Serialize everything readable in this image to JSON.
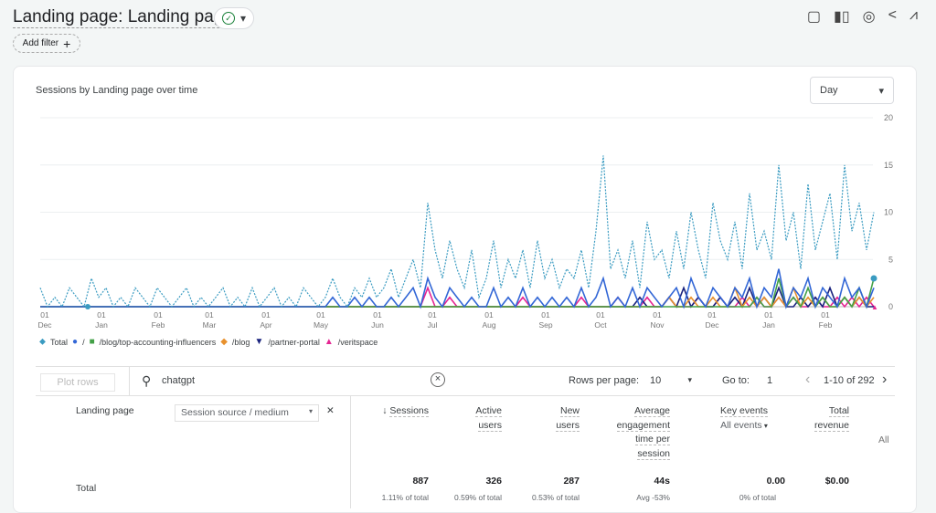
{
  "header": {
    "title": "Landing page: Landing page",
    "add_filter": "Add filter",
    "tools": [
      "note-icon",
      "compare-icon",
      "insights-icon",
      "share-icon",
      "trend-icon"
    ]
  },
  "card": {
    "title": "Sessions by Landing page over time",
    "granularity": "Day"
  },
  "chart_data": {
    "type": "line",
    "x_unit": "day",
    "x_start": "Dec 01",
    "x_step_days": 4,
    "x_ticks": [
      [
        "01",
        "Dec"
      ],
      [
        "01",
        "Jan"
      ],
      [
        "01",
        "Feb"
      ],
      [
        "01",
        "Mar"
      ],
      [
        "01",
        "Apr"
      ],
      [
        "01",
        "May"
      ],
      [
        "01",
        "Jun"
      ],
      [
        "01",
        "Jul"
      ],
      [
        "01",
        "Aug"
      ],
      [
        "01",
        "Sep"
      ],
      [
        "01",
        "Oct"
      ],
      [
        "01",
        "Nov"
      ],
      [
        "01",
        "Dec"
      ],
      [
        "01",
        "Jan"
      ],
      [
        "01",
        "Feb"
      ]
    ],
    "y_ticks": [
      "0",
      "5",
      "10",
      "15",
      "20"
    ],
    "ylim": [
      0,
      20
    ],
    "grid": true,
    "legend": "bottom-left",
    "series": [
      {
        "name": "Total",
        "color": "#3a9bc1",
        "dashed": true,
        "values": [
          2,
          0,
          1,
          0,
          2,
          1,
          0,
          3,
          1,
          2,
          0,
          1,
          0,
          2,
          1,
          0,
          2,
          1,
          0,
          1,
          2,
          0,
          1,
          0,
          1,
          2,
          0,
          1,
          0,
          2,
          0,
          1,
          2,
          0,
          1,
          0,
          2,
          1,
          0,
          1,
          3,
          1,
          0,
          2,
          1,
          3,
          1,
          2,
          4,
          1,
          3,
          5,
          2,
          11,
          6,
          3,
          7,
          4,
          2,
          6,
          1,
          3,
          7,
          2,
          5,
          3,
          6,
          2,
          7,
          3,
          5,
          2,
          4,
          3,
          6,
          2,
          8,
          16,
          4,
          6,
          3,
          7,
          2,
          9,
          5,
          6,
          3,
          8,
          4,
          10,
          6,
          3,
          11,
          7,
          5,
          9,
          4,
          12,
          6,
          8,
          5,
          15,
          7,
          10,
          4,
          13,
          6,
          9,
          12,
          5,
          15,
          8,
          11,
          6,
          10
        ]
      },
      {
        "name": "/",
        "color": "#3367d6",
        "dashed": false,
        "values": [
          0,
          0,
          0,
          0,
          0,
          0,
          0,
          0,
          0,
          0,
          0,
          0,
          0,
          0,
          0,
          0,
          0,
          0,
          0,
          0,
          0,
          0,
          0,
          0,
          0,
          0,
          0,
          0,
          0,
          0,
          0,
          0,
          0,
          0,
          0,
          0,
          0,
          0,
          0,
          0,
          1,
          0,
          0,
          1,
          0,
          1,
          0,
          0,
          1,
          0,
          1,
          2,
          0,
          3,
          1,
          0,
          2,
          1,
          0,
          1,
          0,
          0,
          2,
          0,
          1,
          0,
          2,
          0,
          1,
          0,
          1,
          0,
          1,
          0,
          2,
          0,
          1,
          3,
          0,
          1,
          0,
          2,
          0,
          2,
          1,
          0,
          1,
          2,
          0,
          3,
          1,
          0,
          2,
          1,
          0,
          2,
          1,
          3,
          0,
          2,
          1,
          4,
          0,
          2,
          1,
          3,
          0,
          2,
          1,
          0,
          3,
          1,
          2,
          0,
          2
        ]
      },
      {
        "name": "/blog/top-accounting-influencers",
        "color": "#43a047",
        "dashed": false,
        "values": [
          0,
          0,
          0,
          0,
          0,
          0,
          0,
          0,
          0,
          0,
          0,
          0,
          0,
          0,
          0,
          0,
          0,
          0,
          0,
          0,
          0,
          0,
          0,
          0,
          0,
          0,
          0,
          0,
          0,
          0,
          0,
          0,
          0,
          0,
          0,
          0,
          0,
          0,
          0,
          0,
          0,
          0,
          0,
          0,
          0,
          0,
          0,
          0,
          0,
          0,
          0,
          0,
          0,
          0,
          0,
          0,
          0,
          0,
          0,
          0,
          0,
          0,
          0,
          0,
          0,
          0,
          0,
          0,
          0,
          0,
          0,
          0,
          0,
          0,
          0,
          0,
          0,
          0,
          0,
          0,
          0,
          0,
          0,
          0,
          0,
          0,
          0,
          0,
          0,
          0,
          0,
          0,
          0,
          0,
          0,
          0,
          0,
          0,
          1,
          0,
          0,
          3,
          0,
          1,
          0,
          2,
          0,
          1,
          0,
          0,
          1,
          0,
          2,
          0,
          3
        ]
      },
      {
        "name": "/blog",
        "color": "#e8912d",
        "dashed": false,
        "values": [
          0,
          0,
          0,
          0,
          0,
          0,
          0,
          0,
          0,
          0,
          0,
          0,
          0,
          0,
          0,
          0,
          0,
          0,
          0,
          0,
          0,
          0,
          0,
          0,
          0,
          0,
          0,
          0,
          0,
          0,
          0,
          0,
          0,
          0,
          0,
          0,
          0,
          0,
          0,
          0,
          0,
          0,
          0,
          0,
          0,
          0,
          0,
          0,
          0,
          0,
          0,
          0,
          0,
          0,
          0,
          0,
          0,
          0,
          0,
          0,
          0,
          0,
          0,
          0,
          0,
          0,
          0,
          0,
          0,
          0,
          0,
          0,
          0,
          0,
          0,
          0,
          0,
          0,
          0,
          0,
          0,
          0,
          0,
          0,
          0,
          0,
          1,
          0,
          0,
          1,
          0,
          0,
          1,
          0,
          0,
          2,
          0,
          1,
          0,
          1,
          0,
          1,
          0,
          2,
          0,
          1,
          0,
          1,
          0,
          0,
          1,
          0,
          1,
          0,
          1
        ]
      },
      {
        "name": "/partner-portal",
        "color": "#1a237e",
        "dashed": false,
        "values": [
          0,
          0,
          0,
          0,
          0,
          0,
          0,
          0,
          0,
          0,
          0,
          0,
          0,
          0,
          0,
          0,
          0,
          0,
          0,
          0,
          0,
          0,
          0,
          0,
          0,
          0,
          0,
          0,
          0,
          0,
          0,
          0,
          0,
          0,
          0,
          0,
          0,
          0,
          0,
          0,
          0,
          0,
          0,
          0,
          0,
          0,
          0,
          0,
          0,
          0,
          0,
          0,
          0,
          0,
          0,
          0,
          0,
          0,
          0,
          0,
          0,
          0,
          0,
          0,
          0,
          0,
          0,
          0,
          0,
          0,
          0,
          0,
          0,
          0,
          0,
          0,
          0,
          0,
          0,
          0,
          0,
          0,
          1,
          0,
          0,
          0,
          1,
          0,
          2,
          0,
          1,
          0,
          0,
          1,
          0,
          1,
          0,
          2,
          0,
          1,
          0,
          2,
          0,
          0,
          1,
          0,
          1,
          0,
          2,
          0,
          1,
          0,
          1,
          0,
          0
        ]
      },
      {
        "name": "/veritspace",
        "color": "#e52592",
        "dashed": false,
        "values": [
          0,
          0,
          0,
          0,
          0,
          0,
          0,
          0,
          0,
          0,
          0,
          0,
          0,
          0,
          0,
          0,
          0,
          0,
          0,
          0,
          0,
          0,
          0,
          0,
          0,
          0,
          0,
          0,
          0,
          0,
          0,
          0,
          0,
          0,
          0,
          0,
          0,
          0,
          0,
          0,
          0,
          0,
          0,
          0,
          0,
          0,
          0,
          0,
          0,
          0,
          0,
          0,
          0,
          2,
          0,
          0,
          1,
          0,
          0,
          0,
          0,
          0,
          0,
          0,
          0,
          0,
          1,
          0,
          0,
          0,
          0,
          0,
          0,
          0,
          1,
          0,
          0,
          0,
          0,
          1,
          0,
          0,
          0,
          1,
          0,
          0,
          1,
          0,
          0,
          0,
          1,
          0,
          0,
          1,
          0,
          0,
          1,
          0,
          1,
          0,
          0,
          1,
          0,
          1,
          0,
          0,
          1,
          0,
          0,
          1,
          0,
          1,
          0,
          1,
          0
        ]
      }
    ]
  },
  "table_toolbar": {
    "plot_rows": "Plot rows",
    "search_value": "chatgpt",
    "rows_per_page_label": "Rows per page:",
    "rows_per_page": "10",
    "goto_label": "Go to:",
    "goto_value": "1",
    "range": "1-10 of 292"
  },
  "table": {
    "dim_header": "Landing page",
    "secondary_dim": "Session source / medium",
    "columns": [
      {
        "label": [
          "Sessions"
        ]
      },
      {
        "label": [
          "Active",
          "users"
        ]
      },
      {
        "label": [
          "New",
          "users"
        ]
      },
      {
        "label": [
          "Average",
          "engagement",
          "time per",
          "session"
        ]
      },
      {
        "label": [
          "Key events"
        ],
        "sub": "All events"
      },
      {
        "label": [
          "Total",
          "revenue"
        ]
      }
    ],
    "more": "All",
    "total_label": "Total",
    "totals": [
      "887",
      "326",
      "287",
      "44s",
      "0.00",
      "$0.00"
    ],
    "totals_sub": [
      "1.11% of total",
      "0.59% of total",
      "0.53% of total",
      "Avg -53%",
      "0% of total",
      ""
    ]
  }
}
